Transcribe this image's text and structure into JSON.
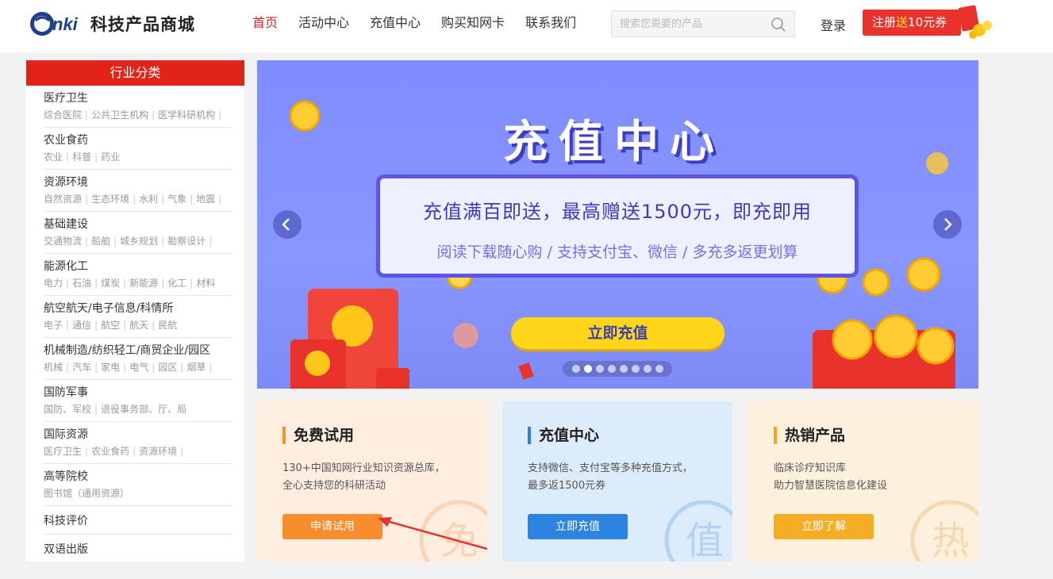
{
  "header": {
    "logo_mark": "CNKI",
    "logo_text": "科技产品商城",
    "nav": [
      "首页",
      "活动中心",
      "充值中心",
      "购买知网卡",
      "联系我们"
    ],
    "search_placeholder": "搜索您需要的产品",
    "login": "登录",
    "register_prefix": "注册",
    "register_highlight": "送",
    "register_suffix": "10元券"
  },
  "sidebar": {
    "title": "行业分类",
    "categories": [
      {
        "name": "医疗卫生",
        "subs": [
          "综合医院",
          "公共卫生机构",
          "医学科研机构"
        ]
      },
      {
        "name": "农业食药",
        "subs": [
          "农业",
          "科普",
          "药业"
        ]
      },
      {
        "name": "资源环境",
        "subs": [
          "自然资源",
          "生态环境",
          "水利",
          "气象",
          "地震"
        ]
      },
      {
        "name": "基础建设",
        "subs": [
          "交通物流",
          "船舶",
          "城乡规划",
          "勘察设计"
        ]
      },
      {
        "name": "能源化工",
        "subs": [
          "电力",
          "石油",
          "煤炭",
          "新能源",
          "化工",
          "材料"
        ]
      },
      {
        "name": "航空航天/电子信息/科情所",
        "subs": [
          "电子",
          "通信",
          "航空",
          "航天",
          "民航"
        ]
      },
      {
        "name": "机械制造/纺织轻工/商贸企业/园区",
        "subs": [
          "机械",
          "汽车",
          "家电",
          "电气",
          "园区",
          "烟草"
        ]
      },
      {
        "name": "国防军事",
        "subs": [
          "国防、军校",
          "退役事务部、厅、局"
        ]
      },
      {
        "name": "国际资源",
        "subs": [
          "医疗卫生",
          "农业食药",
          "资源环境"
        ]
      },
      {
        "name": "高等院校",
        "subs": [
          "图书馆（通用资源）"
        ]
      },
      {
        "name": "科技评价",
        "subs": []
      },
      {
        "name": "双语出版",
        "subs": []
      }
    ]
  },
  "banner": {
    "title": "充值中心",
    "line1": "充值满百即送，最高赠送1500元，即充即用",
    "line2": "阅读下载随心购 / 支持支付宝、微信 / 多充多返更划算",
    "button": "立即充值",
    "slides_count": 8,
    "active_slide": 2
  },
  "cards": [
    {
      "title": "免费试用",
      "desc1": "130+中国知网行业知识资源总库，",
      "desc2": "全心支持您的科研活动",
      "button": "申请试用",
      "watermark": "免"
    },
    {
      "title": "充值中心",
      "desc1": "支持微信、支付宝等多种充值方式，",
      "desc2": "最多返1500元券",
      "button": "立即充值",
      "watermark": "值"
    },
    {
      "title": "热销产品",
      "desc1": "临床诊疗知识库",
      "desc2": "助力智慧医院信息化建设",
      "button": "立即了解",
      "watermark": "热"
    }
  ]
}
